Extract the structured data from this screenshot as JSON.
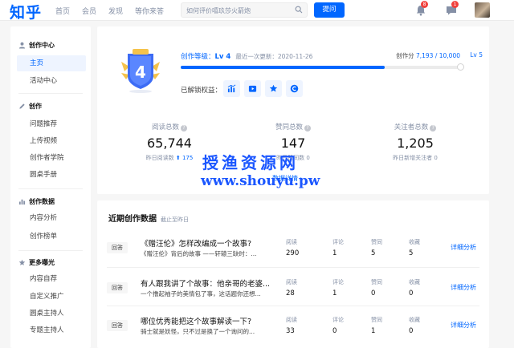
{
  "header": {
    "logo": "知乎",
    "nav": [
      "首页",
      "会员",
      "发现",
      "等你来答"
    ],
    "search_placeholder": "如何评价嘻玖莎火箭炮",
    "ask_label": "提问",
    "notifications_count": "8",
    "messages_count": "1"
  },
  "sidebar": {
    "sections": [
      {
        "title": "创作中心",
        "items": [
          "主页",
          "活动中心"
        ]
      },
      {
        "title": "创作",
        "items": [
          "问题推荐",
          "上传视频",
          "创作者学院",
          "圆桌手册"
        ]
      },
      {
        "title": "创作数据",
        "items": [
          "内容分析",
          "创作榜单"
        ]
      },
      {
        "title": "更多曝光",
        "items": [
          "内容自荐",
          "自定义推广",
          "圆桌主持人",
          "专题主持人"
        ]
      }
    ],
    "active_item": "主页"
  },
  "level": {
    "badge_number": "4",
    "title_prefix": "创作等级：",
    "level": "Lv 4",
    "last_update": "最近一次更新：2020-11-26",
    "score_prefix": "创作分",
    "score": "7,193 / 10,000",
    "next_level": "Lv 5",
    "progress": 0.719,
    "unlocked_label": "已解锁权益：",
    "perks": [
      "chart-icon",
      "video-icon",
      "star-icon",
      "c-icon"
    ]
  },
  "stats": [
    {
      "label": "阅读总数",
      "value": "65,744",
      "sub": "昨日阅读数",
      "delta": "175"
    },
    {
      "label": "赞同总数",
      "value": "147",
      "sub": "昨日赞同数 0",
      "delta": ""
    },
    {
      "label": "关注者总数",
      "value": "1,205",
      "sub": "昨日新增关注者 0",
      "delta": ""
    }
  ],
  "detail_link": "数据详情 ›",
  "watermark": {
    "line1": "授渔资源网",
    "line2": "www.shouyu.pw"
  },
  "recent": {
    "title": "近期创作数据",
    "note": "截止至昨日",
    "metric_labels": [
      "阅读",
      "评论",
      "赞同",
      "收藏"
    ],
    "more_label": "详细分析",
    "rows": [
      {
        "tag": "回答",
        "question": "《赠汪伦》怎样改编成一个故事?",
        "answer": "《赠汪伦》背后的故事 ——轩辕三缺时：...",
        "values": [
          "290",
          "1",
          "5",
          "5"
        ]
      },
      {
        "tag": "回答",
        "question": "有人跟我讲了个故事：他亲哥的老婆...",
        "answer": "一个撸起袖子的美情包了事，这话题你还想...",
        "values": [
          "28",
          "1",
          "0",
          "0"
        ]
      },
      {
        "tag": "回答",
        "question": "哪位优秀能把这个故事解读一下?",
        "answer": "骑士就是妖怪，只不过是换了一个询问的...",
        "values": [
          "33",
          "0",
          "1",
          "0"
        ]
      }
    ]
  },
  "colors": {
    "brand": "#0066ff",
    "muted": "#8590a6",
    "badge_red": "#f1403c"
  }
}
